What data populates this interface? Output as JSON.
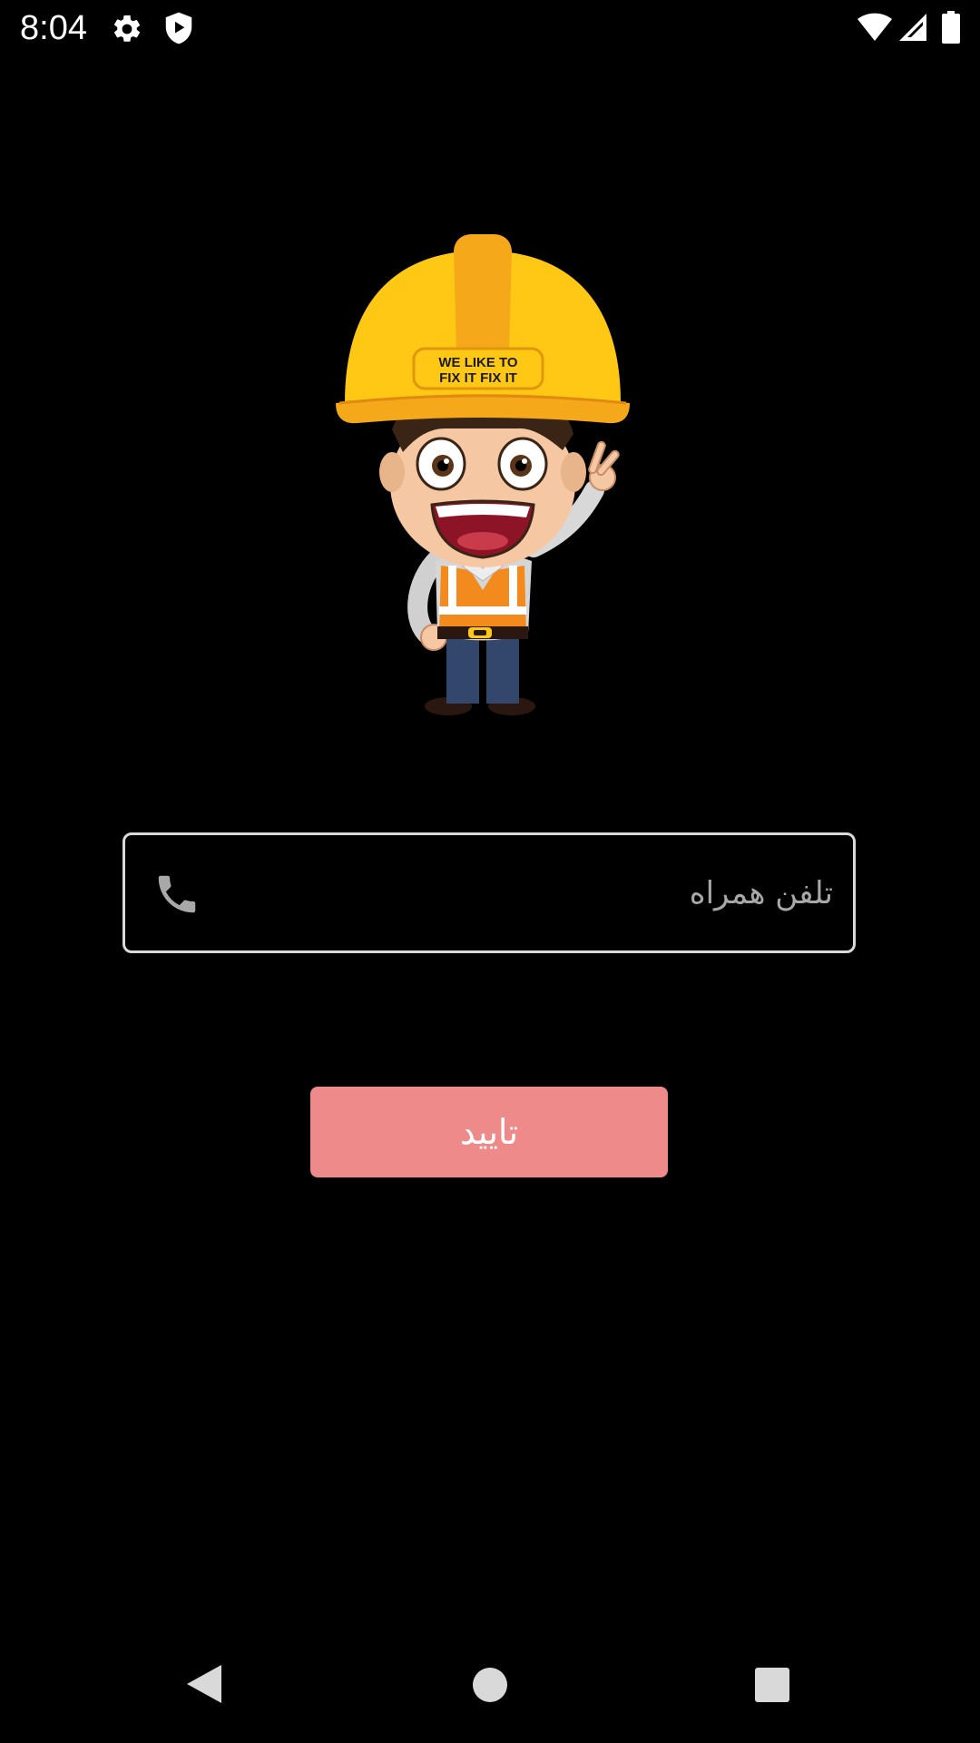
{
  "status_bar": {
    "time": "8:04",
    "icons": [
      "gear-icon",
      "shield-play-icon",
      "wifi-icon",
      "signal-icon",
      "battery-icon"
    ]
  },
  "mascot": {
    "helmet_text_line1": "WE LIKE TO",
    "helmet_text_line2": "FIX IT FIX IT"
  },
  "login_form": {
    "phone_placeholder": "تلفن همراه",
    "phone_value": "",
    "phone_icon": "phone-icon",
    "confirm_label": "تایید"
  },
  "nav_bar": {
    "buttons": [
      "back-icon",
      "home-icon",
      "recents-icon"
    ]
  },
  "colors": {
    "background": "#000000",
    "button": "#ef8a8a",
    "field_border": "#d9d9d9",
    "placeholder": "#a8a8a8",
    "helmet": "#ffc814",
    "vest": "#f28a1e"
  }
}
